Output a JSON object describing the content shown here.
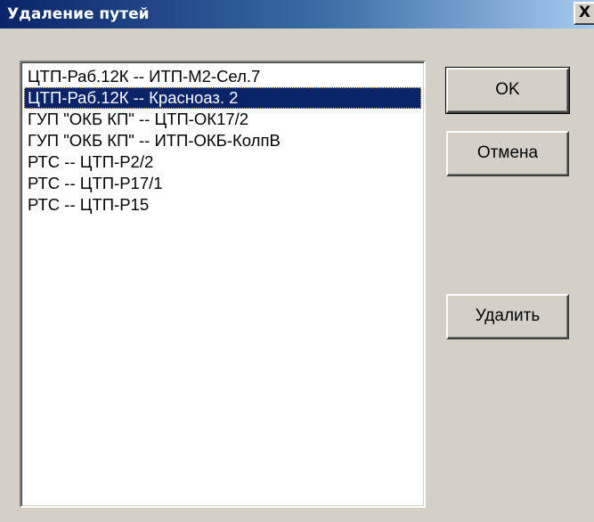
{
  "window": {
    "title": "Удаление путей",
    "close_label": "X"
  },
  "paths_list": {
    "selected_index": 1,
    "items": [
      "ЦТП-Раб.12К -- ИТП-М2-Сел.7",
      "ЦТП-Раб.12К -- Красноаз. 2",
      "ГУП \"ОКБ КП\" -- ЦТП-ОК17/2",
      "ГУП \"ОКБ КП\" -- ИТП-ОКБ-КолпВ",
      "РТС -- ЦТП-Р2/2",
      "РТС -- ЦТП-Р17/1",
      "РТС -- ЦТП-Р15"
    ]
  },
  "buttons": {
    "ok_label": "OK",
    "cancel_label": "Отмена",
    "delete_label": "Удалить"
  },
  "colors": {
    "titlebar_start": "#0a246a",
    "titlebar_end": "#a6caf0",
    "selection": "#0a246a",
    "dialog_face": "#d4d0c8"
  }
}
